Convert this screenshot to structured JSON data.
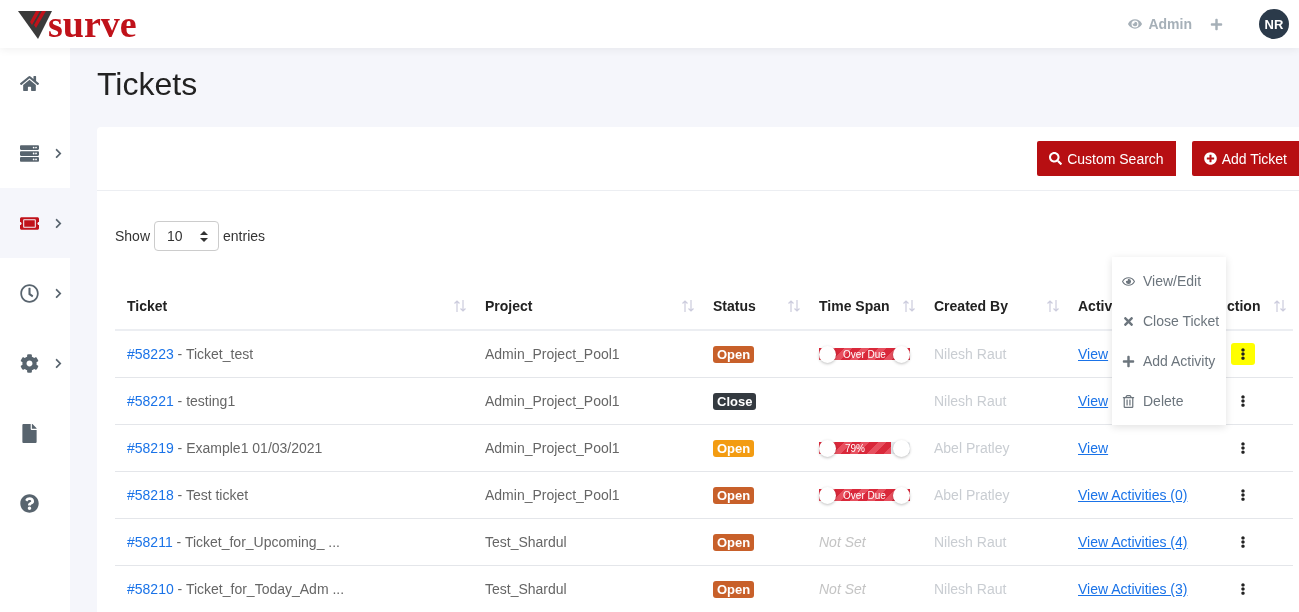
{
  "header": {
    "logo_text": "surve",
    "role": "Admin",
    "avatar": "NR"
  },
  "sidebar": {
    "items": [
      {
        "kind": "home",
        "expandable": false,
        "selected": false
      },
      {
        "kind": "server",
        "expandable": true,
        "selected": false
      },
      {
        "kind": "ticket",
        "expandable": true,
        "selected": true
      },
      {
        "kind": "clock",
        "expandable": true,
        "selected": false
      },
      {
        "kind": "settings",
        "expandable": true,
        "selected": false
      },
      {
        "kind": "file",
        "expandable": false,
        "selected": false
      },
      {
        "kind": "help",
        "expandable": false,
        "selected": false
      }
    ]
  },
  "page_title": "Tickets",
  "toolbar": {
    "buttons": [
      {
        "kind": "search",
        "label": "Custom Search"
      },
      {
        "kind": "add",
        "label": "Add Ticket"
      }
    ]
  },
  "length_menu": {
    "before": "Show",
    "value": "10",
    "after": "entries"
  },
  "table": {
    "columns": [
      "Ticket",
      "Project",
      "Status",
      "Time Span",
      "Created By",
      "Activ",
      "ction"
    ],
    "rows": [
      {
        "id": "#58223",
        "title": " - Ticket_test",
        "project": "Admin_Project_Pool1",
        "status": {
          "label": "Open",
          "color": "#c8602a"
        },
        "time_span": {
          "kind": "overdue",
          "label": "Over Due",
          "level": 1
        },
        "created_by": "Nilesh Raut",
        "activities": "View",
        "action_highlighted": true
      },
      {
        "id": "#58221",
        "title": " - testing1",
        "project": "Admin_Project_Pool1",
        "status": {
          "label": "Close",
          "color": "#343a40"
        },
        "time_span": {
          "kind": "none"
        },
        "created_by": "Nilesh Raut",
        "activities": "View",
        "action_highlighted": false
      },
      {
        "id": "#58219",
        "title": " - Example1 01/03/2021",
        "project": "Admin_Project_Pool1",
        "status": {
          "label": "Open",
          "color": "#f39c12"
        },
        "time_span": {
          "kind": "progress",
          "label": "79%",
          "level": 0.79
        },
        "created_by": "Abel Pratley",
        "activities": "View",
        "action_highlighted": false
      },
      {
        "id": "#58218",
        "title": " - Test ticket",
        "project": "Admin_Project_Pool1",
        "status": {
          "label": "Open",
          "color": "#c8602a"
        },
        "time_span": {
          "kind": "overdue",
          "label": "Over Due",
          "level": 1
        },
        "created_by": "Abel Pratley",
        "activities": "View Activities (0)",
        "action_highlighted": false
      },
      {
        "id": "#58211",
        "title": " - Ticket_for_Upcoming_ ...",
        "project": "Test_Shardul",
        "status": {
          "label": "Open",
          "color": "#c8602a"
        },
        "time_span": {
          "kind": "not_set",
          "label": "Not Set"
        },
        "created_by": "Nilesh Raut",
        "activities": "View Activities (4)",
        "action_highlighted": false
      },
      {
        "id": "#58210",
        "title": " - Ticket_for_Today_Adm ...",
        "project": "Test_Shardul",
        "status": {
          "label": "Open",
          "color": "#c8602a"
        },
        "time_span": {
          "kind": "not_set",
          "label": "Not Set"
        },
        "created_by": "Nilesh Raut",
        "activities": "View Activities (3)",
        "action_highlighted": false
      }
    ]
  },
  "action_menu": {
    "items": [
      {
        "kind": "view",
        "label": "View/Edit"
      },
      {
        "kind": "close",
        "label": "Close Ticket"
      },
      {
        "kind": "add",
        "label": "Add Activity"
      },
      {
        "kind": "delete",
        "label": "Delete"
      }
    ]
  }
}
